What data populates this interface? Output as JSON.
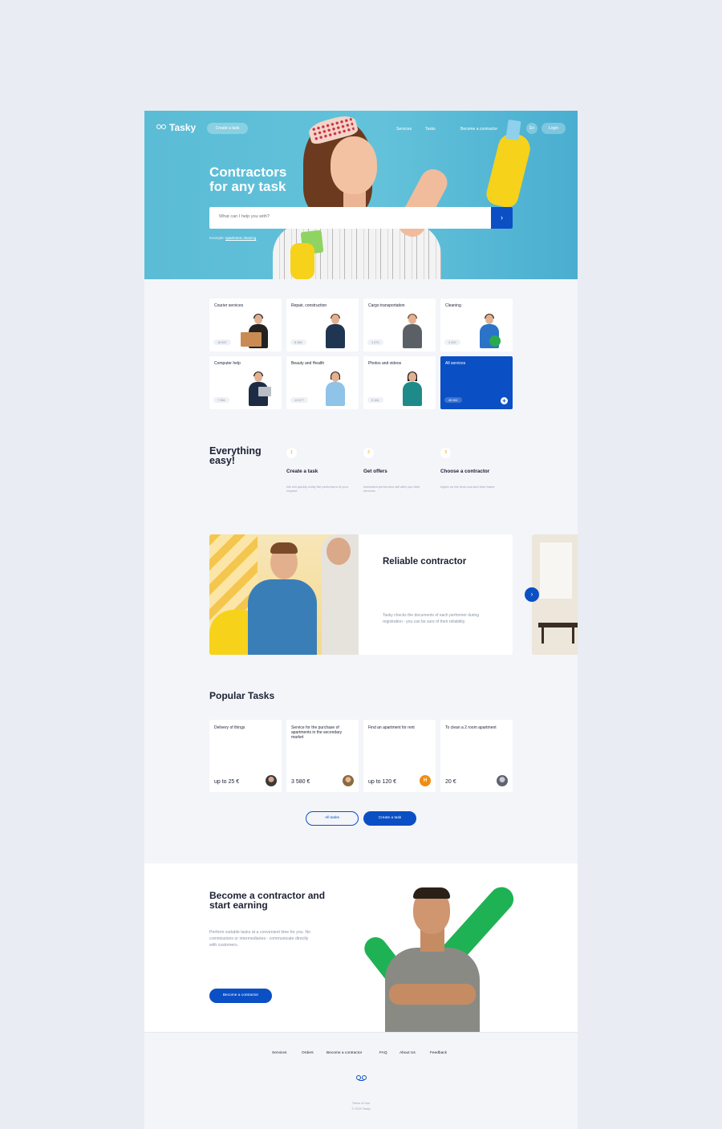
{
  "header": {
    "brand": "Tasky",
    "create_task": "Create a task",
    "nav": [
      "Services",
      "Tasks",
      "Become a contractor"
    ],
    "lang": "En",
    "login": "Login"
  },
  "hero": {
    "title_line1": "Contractors",
    "title_line2": "for any task",
    "search_placeholder": "What can I help you with?",
    "example_prefix": "Example:",
    "example_link": "apartment cleaning"
  },
  "categories": [
    {
      "label": "Courier services",
      "count": "16 837"
    },
    {
      "label": "Repair, construction",
      "count": "8 456"
    },
    {
      "label": "Cargo transportation",
      "count": "1 073"
    },
    {
      "label": "Cleaning",
      "count": "3 200"
    },
    {
      "label": "Computer help",
      "count": "7 306"
    },
    {
      "label": "Beauty and Health",
      "count": "12 677"
    },
    {
      "label": "Photos and videos",
      "count": "5 164"
    },
    {
      "label": "All services",
      "count": "45 062"
    }
  ],
  "easy": {
    "title": "Everything easy!",
    "steps": [
      {
        "num": "1",
        "title": "Create a task",
        "desc": "We will quickly notify the performers of your request"
      },
      {
        "num": "2",
        "title": "Get offers",
        "desc": "Interested performers will offer you their services"
      },
      {
        "num": "3",
        "title": "Choose a contractor",
        "desc": "Agree on the final cost and time frame"
      }
    ]
  },
  "reliable": {
    "title": "Reliable contractor",
    "text": "Tasky checks the documents of each performer during registration - you can be sure of their reliability."
  },
  "popular": {
    "title": "Popular Tasks",
    "tasks": [
      {
        "title": "Delivery of things",
        "price": "up to 25 €"
      },
      {
        "title": "Service for the purchase of apartments in the secondary market",
        "price": "3 580 €"
      },
      {
        "title": "Find an apartment for rent",
        "price": "up to 120 €",
        "avatar": "H"
      },
      {
        "title": "To clean a 2 room apartment",
        "price": "20 €"
      }
    ],
    "all_tasks": "All tasks",
    "create_task": "Create a task"
  },
  "become": {
    "title": "Become a contractor and start earning",
    "text": "Perform suitable tasks at a convenient time for you. No commissions or intermediaries - communicate directly with customers.",
    "button": "Become a contractor"
  },
  "footer": {
    "nav": [
      "Services",
      "Orders",
      "Become a contractor",
      "FAQ",
      "About Us",
      "Feedback"
    ],
    "terms": "Terms of Use",
    "copyright": "© 2019 Tasky"
  },
  "colors": {
    "accent": "#0b4fc4",
    "hero_bg": "#5bbcd6",
    "check_green": "#1fb254",
    "step_number": "#f28c0f"
  },
  "icons": {
    "logo": "tasky-logo-icon",
    "search_submit": "chevron-right-icon",
    "all_services": "plus-icon",
    "carousel_next": "chevron-right-icon"
  }
}
